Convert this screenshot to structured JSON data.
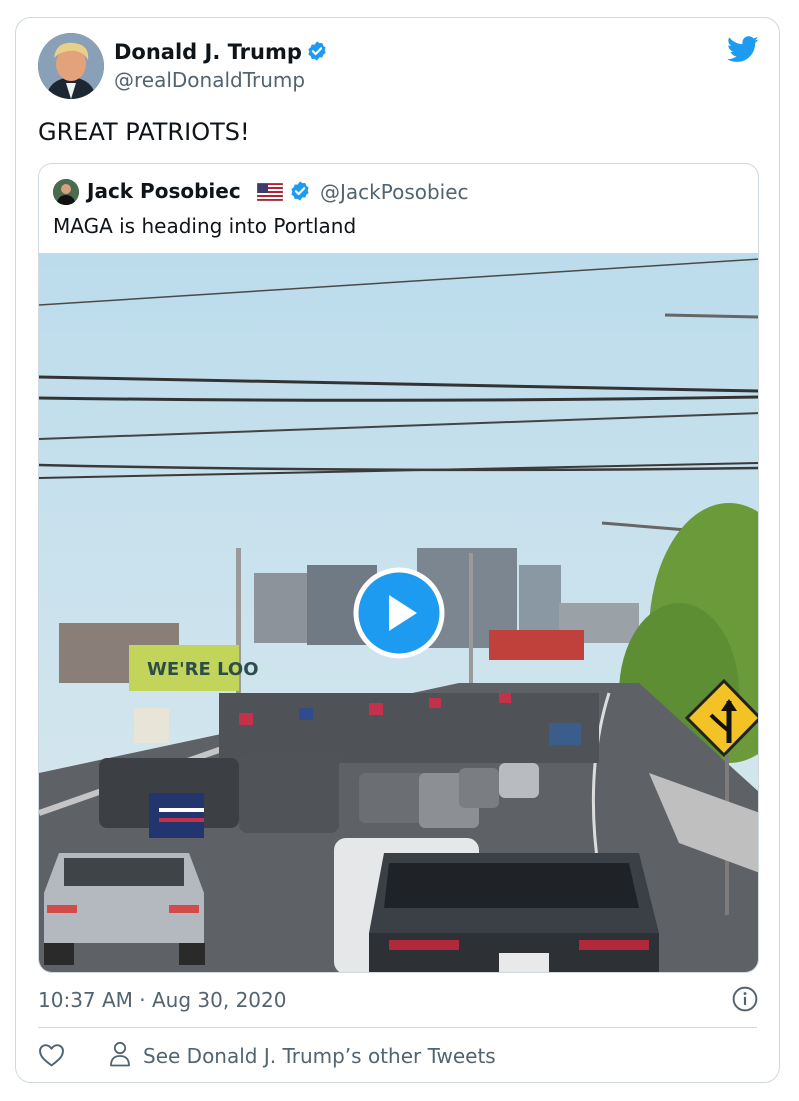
{
  "tweet": {
    "author_name": "Donald J. Trump",
    "author_handle": "@realDonaldTrump",
    "text": "GREAT PATRIOTS!",
    "timestamp": "10:37 AM · Aug 30, 2020"
  },
  "quoted_tweet": {
    "author_name": "Jack Posobiec",
    "author_handle": "@JackPosobiec",
    "text": "MAGA is heading into Portland",
    "media": {
      "billboard_text": "WE'RE LOO",
      "type": "video"
    }
  },
  "footer": {
    "other_tweets_label": "See Donald J. Trump’s other Tweets"
  },
  "icons": {
    "brand": "twitter-bird-icon",
    "verified": "verified-badge-icon",
    "flag": "us-flag-icon",
    "play": "play-icon",
    "info": "info-icon",
    "like": "heart-icon",
    "profile": "person-icon"
  },
  "colors": {
    "brand_blue": "#1d9bf0",
    "text_primary": "#0f1419",
    "text_secondary": "#536471",
    "border": "#cfd9de"
  }
}
